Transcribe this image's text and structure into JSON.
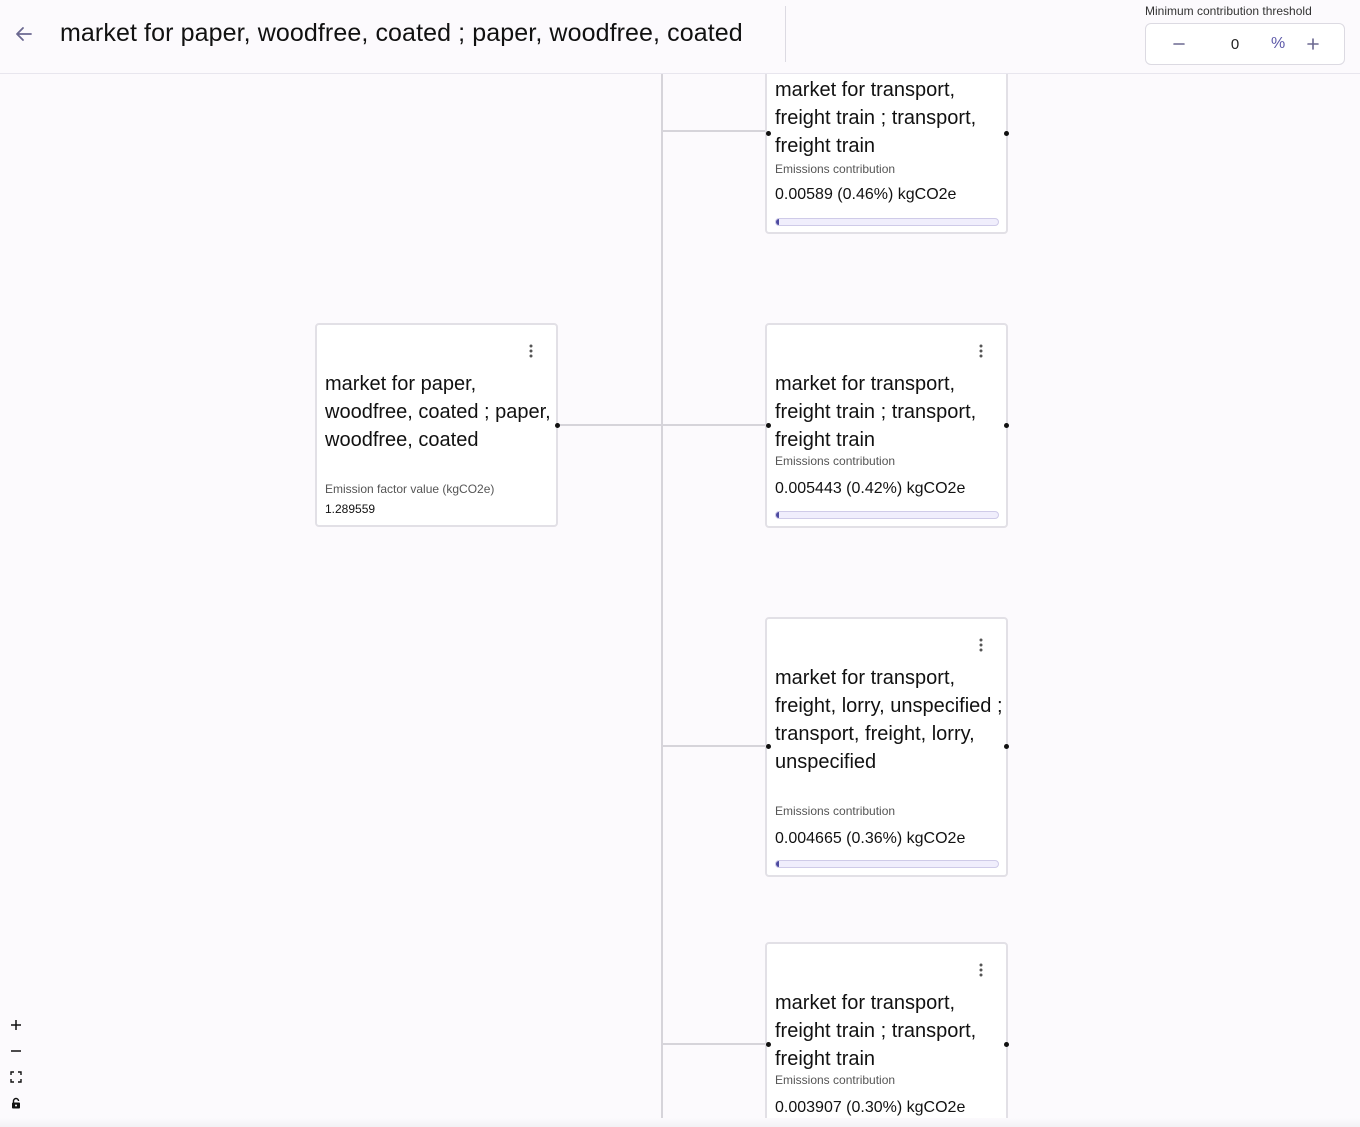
{
  "header": {
    "title": "market for paper, woodfree, coated ; paper, woodfree, coated",
    "back_icon": "arrow-left-icon",
    "threshold": {
      "label": "Minimum contribution threshold",
      "value": "0",
      "unit": "%",
      "minus_icon": "minus-icon",
      "plus_icon": "plus-icon"
    }
  },
  "colors": {
    "accent": "#5c58a8",
    "bar_fill": "#4d4aa0",
    "bar_track": "#f0eefc",
    "background": "#fcfafd"
  },
  "root_node": {
    "title": "market for paper, woodfree, coated ; paper, woodfree, coated",
    "sub_label": "Emission factor value (kgCO2e)",
    "value": "1.289559"
  },
  "child_nodes": [
    {
      "title": "market for transport, freight train ; transport, freight train",
      "sub_label": "Emissions contribution",
      "value": "0.00589 (0.46%) kgCO2e",
      "share": 0.46
    },
    {
      "title": "market for transport, freight train ; transport, freight train",
      "sub_label": "Emissions contribution",
      "value": "0.005443 (0.42%) kgCO2e",
      "share": 0.42
    },
    {
      "title": "market for transport, freight, lorry, unspecified ; transport, freight, lorry, unspecified",
      "sub_label": "Emissions contribution",
      "value": "0.004665 (0.36%) kgCO2e",
      "share": 0.36
    },
    {
      "title": "market for transport, freight train ; transport, freight train",
      "sub_label": "Emissions contribution",
      "value": "0.003907 (0.30%) kgCO2e",
      "share": 0.3
    }
  ],
  "zoom_controls": [
    "zoom-in-icon",
    "zoom-out-icon",
    "fit-view-icon",
    "lock-icon"
  ]
}
